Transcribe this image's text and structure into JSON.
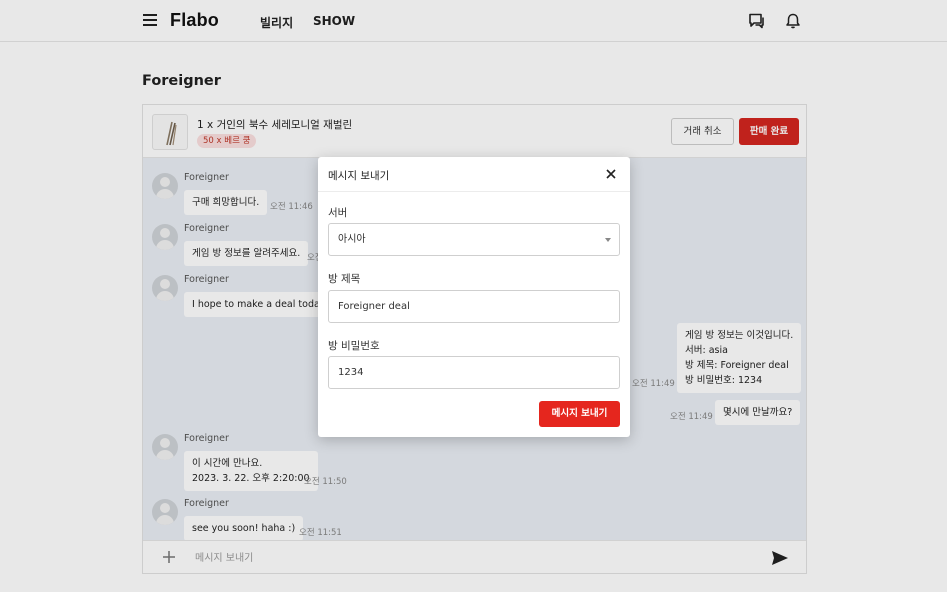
{
  "header": {
    "logo": "Flabo",
    "nav": [
      "빌리지",
      "SHOW"
    ]
  },
  "page": {
    "title": "Foreigner"
  },
  "product": {
    "name": "1 x 거인의 북수 세레모니얼 재벌린",
    "tag": "50 x 베르 쿵",
    "cancel_label": "거래 취소",
    "complete_label": "판매 완료"
  },
  "messages": [
    {
      "side": "left",
      "sender": "Foreigner",
      "text": "구매 희망합니다.",
      "time": "오전 11:46"
    },
    {
      "side": "left",
      "sender": "Foreigner",
      "text": "게임 방 정보를 알려주세요.",
      "time": "오전 11:47"
    },
    {
      "side": "left",
      "sender": "Foreigner",
      "text": "I hope to make a deal today.",
      "time": ""
    },
    {
      "side": "right",
      "text": "게임 방 정보는 이것입니다.\n서버: asia\n방 제목: Foreigner deal\n방 비밀번호: 1234",
      "time": "오전 11:49"
    },
    {
      "side": "right",
      "text": "몇시에 만날까요?",
      "time": "오전 11:49"
    },
    {
      "side": "left",
      "sender": "Foreigner",
      "text": "이 시간에 만나요.\n2023. 3. 22. 오후 2:20:00",
      "time": "오전 11:50"
    },
    {
      "side": "left",
      "sender": "Foreigner",
      "text": "see you soon! haha :)",
      "time": "오전 11:51"
    }
  ],
  "chat_input": {
    "placeholder": "메시지 보내기"
  },
  "modal": {
    "title": "메시지 보내기",
    "server_label": "서버",
    "server_value": "아시아",
    "room_title_label": "방 제목",
    "room_title_value": "Foreigner deal",
    "room_password_label": "방 비밀번호",
    "room_password_value": "1234",
    "submit_label": "메시지 보내기"
  },
  "colors": {
    "accent_red": "#d3261f",
    "chat_bg": "#eaeef4",
    "tag_bg": "#fbe0e0"
  },
  "icons": [
    "menu-icon",
    "chat-icon",
    "bell-icon",
    "close-icon",
    "plus-icon",
    "send-icon",
    "chevron-down-icon"
  ]
}
